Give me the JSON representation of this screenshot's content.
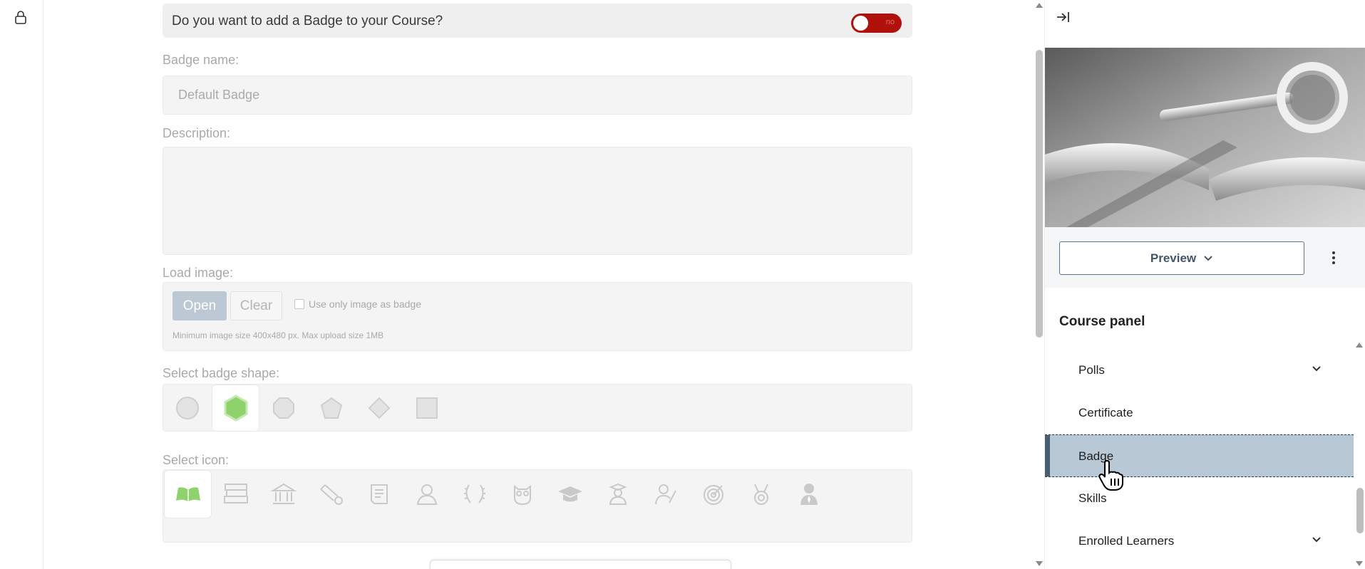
{
  "badge_toggle": {
    "question": "Do you want to add a Badge to your Course?",
    "state_label": "no"
  },
  "badge_name": {
    "label": "Badge name:",
    "value": "Default Badge"
  },
  "description": {
    "label": "Description:",
    "value": ""
  },
  "load_image": {
    "label": "Load image:",
    "open_label": "Open",
    "clear_label": "Clear",
    "checkbox_label": "Use only image as badge",
    "hint": "Minimum image size 400x480 px. Max upload size 1MB"
  },
  "badge_shape": {
    "label": "Select badge shape:",
    "shapes": [
      "circle",
      "hexagon",
      "octagon",
      "pentagon",
      "diamond",
      "square"
    ],
    "selected": "hexagon"
  },
  "select_icon": {
    "label": "Select icon:",
    "icons": [
      "open-book-icon",
      "books-icon",
      "institution-icon",
      "diploma-scroll-icon",
      "certificate-icon",
      "user-icon",
      "laurel-wreath-icon",
      "owl-icon",
      "graduation-cap-icon",
      "graduate-icon",
      "teacher-icon",
      "target-icon",
      "medal-icon",
      "businessman-icon"
    ],
    "selected": "open-book-icon"
  },
  "panel": {
    "preview_label": "Preview",
    "title": "Course panel",
    "items": [
      {
        "label": "Polls",
        "expandable": true
      },
      {
        "label": "Certificate",
        "expandable": false
      },
      {
        "label": "Badge",
        "expandable": false,
        "active": true
      },
      {
        "label": "Skills",
        "expandable": false
      },
      {
        "label": "Enrolled Learners",
        "expandable": true
      }
    ]
  },
  "colors": {
    "toggle_off": "#b0110b",
    "active_item_bg": "#b8c8d5",
    "active_item_bar": "#465e72",
    "selected_green": "#8dd26a",
    "open_button": "#bcc9d4"
  }
}
